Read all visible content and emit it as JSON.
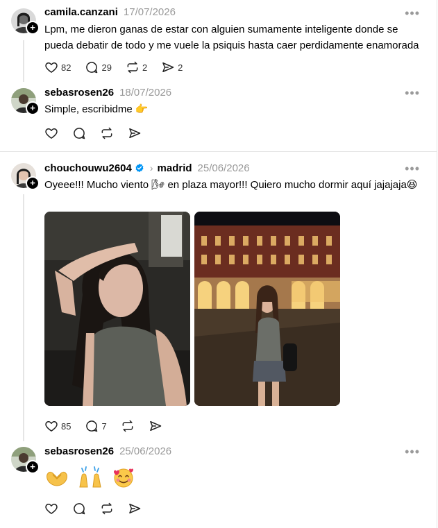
{
  "posts": [
    {
      "username": "camila.canzani",
      "date": "17/07/2026",
      "text": "Lpm, me dieron ganas de estar con alguien sumamente inteligente donde se pueda debatir de todo y me vuele la psiquis hasta caer perdidamente enamorada",
      "likes": "82",
      "comments": "29",
      "reposts": "2",
      "shares": "2"
    },
    {
      "username": "sebasrosen26",
      "date": "18/07/2026",
      "text": "Simple, escribidme 👉"
    },
    {
      "username": "chouchouwu2604",
      "topic": "madrid",
      "date": "25/06/2026",
      "text": "Oyeee!!! Mucho viento 🌬 en plaza mayor!!! Quiero mucho dormir aquí jajajaja😆",
      "likes": "85",
      "comments": "7"
    },
    {
      "username": "sebasrosen26",
      "date": "25/06/2026",
      "emojis": [
        "🫶",
        "🙌",
        "🥰"
      ]
    }
  ],
  "icons": {
    "more": "more-icon",
    "like": "heart-icon",
    "comment": "comment-icon",
    "repost": "repost-icon",
    "share": "send-icon",
    "verified": "verified-badge-icon"
  },
  "colors": {
    "verified": "#0095f6",
    "muted": "#999999",
    "divider": "#e3e3e3"
  }
}
